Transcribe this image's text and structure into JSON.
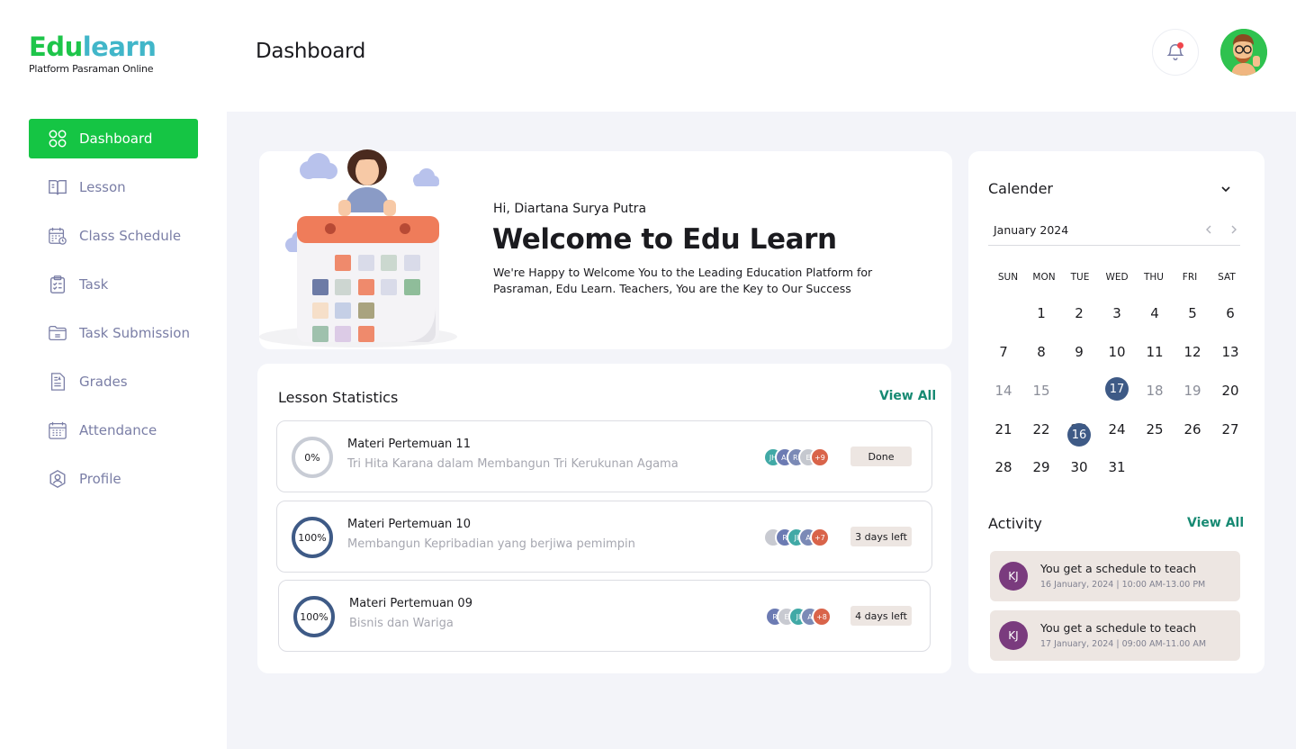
{
  "brand": {
    "name_part1": "Edu",
    "name_part2": "learn",
    "subtitle": "Platform Pasraman Online"
  },
  "header": {
    "title": "Dashboard"
  },
  "sidebar": {
    "items": [
      {
        "label": "Dashboard",
        "icon": "grid-icon",
        "active": true
      },
      {
        "label": "Lesson",
        "icon": "book-icon"
      },
      {
        "label": "Class Schedule",
        "icon": "calendar-clock-icon"
      },
      {
        "label": "Task",
        "icon": "clipboard-icon"
      },
      {
        "label": "Task Submission",
        "icon": "folder-icon"
      },
      {
        "label": "Grades",
        "icon": "document-icon"
      },
      {
        "label": "Attendance",
        "icon": "calendar-grid-icon"
      },
      {
        "label": "Profile",
        "icon": "user-circle-icon"
      }
    ]
  },
  "welcome": {
    "greeting": "Hi, Diartana Surya Putra",
    "title": "Welcome to Edu Learn",
    "description": "We're Happy to Welcome You to the Leading Education Platform for Pasraman, Edu Learn. Teachers, You are the Key to Our Success"
  },
  "stats": {
    "title": "Lesson Statistics",
    "view_all": "View All",
    "lessons": [
      {
        "progress": "0%",
        "title": "Materi Pertemuan 11",
        "subtitle": "Tri Hita Karana dalam Membangun Tri Kerukunan Agama",
        "avatars": [
          "JH",
          "AI",
          "RI",
          "E"
        ],
        "more": "+9",
        "status": "Done"
      },
      {
        "progress": "100%",
        "title": "Materi Pertemuan 10",
        "subtitle": "Membangun Kepribadian yang berjiwa pemimpin",
        "avatars": [
          "",
          "R",
          "JI",
          "A"
        ],
        "more": "+7",
        "status": "3 days left"
      },
      {
        "progress": "100%",
        "title": "Materi Pertemuan 09",
        "subtitle": "Bisnis dan Wariga",
        "avatars": [
          "R",
          "E",
          "JI",
          "A"
        ],
        "more": "+8",
        "status": "4 days left"
      }
    ]
  },
  "calendar": {
    "title": "Calender",
    "month": "January 2024",
    "weekdays": [
      "SUN",
      "MON",
      "TUE",
      "WED",
      "THU",
      "FRI",
      "SAT"
    ],
    "selected_days": [
      "17",
      "16"
    ]
  },
  "activity": {
    "title": "Activity",
    "view_all": "View All",
    "items": [
      {
        "initials": "KJ",
        "text": "You get a schedule to teach",
        "time": "16 January, 2024 | 10:00 AM-13.00 PM"
      },
      {
        "initials": "KJ",
        "text": "You get a schedule to teach",
        "time": "17 January, 2024 | 09:00 AM-11.00 AM"
      }
    ]
  },
  "colors": {
    "brand_green": "#15c544",
    "accent_teal": "#178a73",
    "navy": "#3e5a86",
    "muted_nav": "#7a7ea6"
  }
}
